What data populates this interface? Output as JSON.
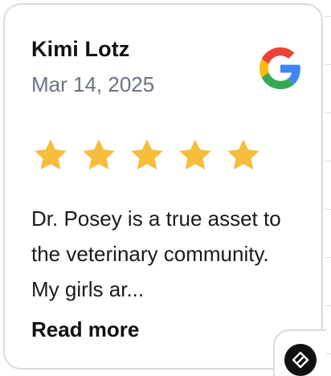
{
  "review": {
    "name": "Kimi Lotz",
    "date": "Mar 14, 2025",
    "rating": 5,
    "rating_max": 5,
    "text": "Dr. Posey is a true asset to the veterinary community. My girls ar...",
    "read_more_label": "Read more"
  },
  "source": {
    "icon": "google-logo-icon"
  },
  "widget": {
    "icon": "widget-brand-icon"
  },
  "colors": {
    "star": "#F6BD3B",
    "name": "#111111",
    "date": "#6B7280",
    "card_border": "#D7DBE0",
    "badge_bg": "#111111"
  }
}
